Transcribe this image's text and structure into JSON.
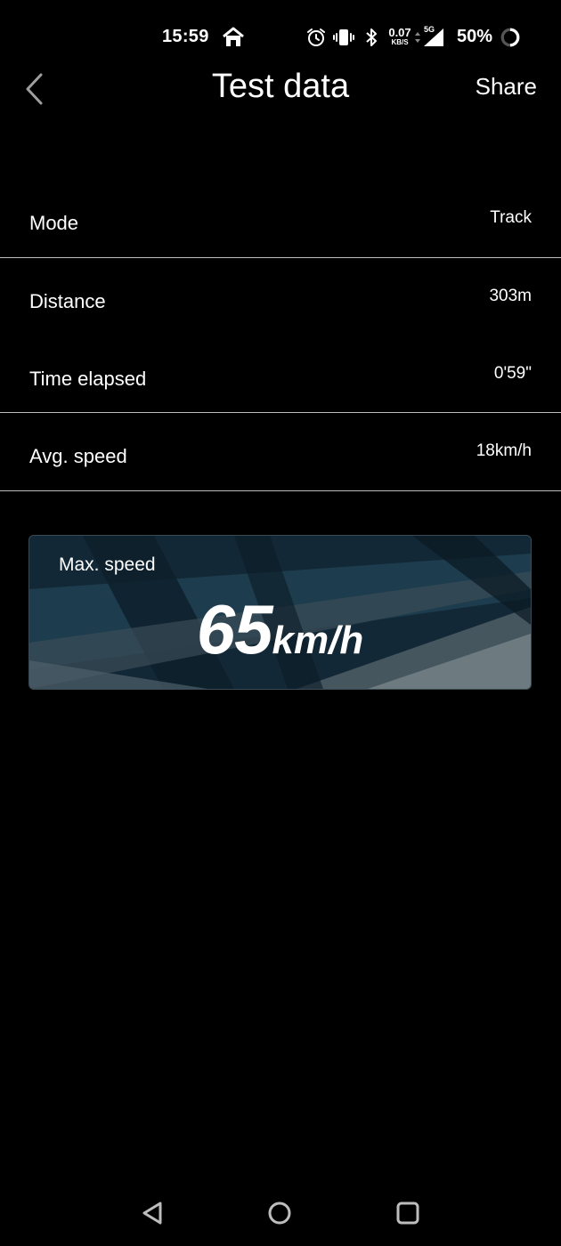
{
  "status_bar": {
    "time": "15:59",
    "net_speed_value": "0.07",
    "net_speed_unit": "KB/S",
    "network_type": "5G",
    "battery": "50%",
    "icons": [
      "home-icon",
      "alarm-icon",
      "vibrate-icon",
      "bluetooth-icon",
      "data-arrows-icon",
      "signal-icon",
      "battery-ring-icon"
    ]
  },
  "header": {
    "title": "Test data",
    "share_label": "Share",
    "back_icon": "chevron-left-icon"
  },
  "rows": [
    {
      "label": "Mode",
      "value": "Track"
    },
    {
      "label": "Distance",
      "value": "303m"
    },
    {
      "label": "Time elapsed",
      "value": "0'59\""
    },
    {
      "label": "Avg. speed",
      "value": "18km/h"
    }
  ],
  "max_speed": {
    "label": "Max. speed",
    "value": "65",
    "unit": "km/h"
  },
  "nav_bar": {
    "icons": [
      "nav-back-icon",
      "nav-home-icon",
      "nav-recent-icon"
    ]
  },
  "colors": {
    "background": "#000000",
    "text": "#ffffff",
    "divider": "#bdbdbd",
    "card_base": "#142a37"
  }
}
